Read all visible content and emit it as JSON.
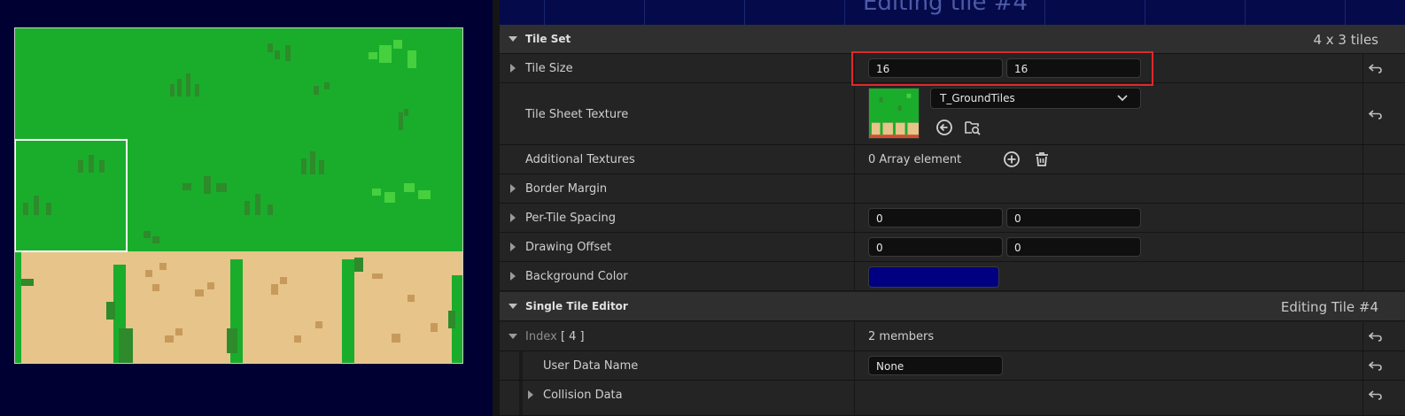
{
  "viewport": {
    "background": "#000033",
    "grass_color": "#1aad2c",
    "dirt_color": "#e6c48a",
    "selection_color": "#ffffff",
    "selected_tile_index": 4
  },
  "details": {
    "header_title": "Editing tile #4",
    "tile_set": {
      "label": "Tile Set",
      "info": "4 x 3 tiles"
    },
    "rows": {
      "tile_size": {
        "label": "Tile Size",
        "x": "16",
        "y": "16"
      },
      "tile_sheet_texture": {
        "label": "Tile Sheet Texture",
        "asset": "T_GroundTiles"
      },
      "additional_textures": {
        "label": "Additional Textures",
        "value": "0 Array element"
      },
      "border_margin": {
        "label": "Border Margin"
      },
      "per_tile_spacing": {
        "label": "Per-Tile Spacing",
        "x": "0",
        "y": "0"
      },
      "drawing_offset": {
        "label": "Drawing Offset",
        "x": "0",
        "y": "0"
      },
      "background_color": {
        "label": "Background Color",
        "color": "#000080"
      }
    },
    "single_tile_editor": {
      "label": "Single Tile Editor",
      "info": "Editing Tile #4"
    },
    "index_row": {
      "label": "Index",
      "index_value": "[ 4 ]",
      "value": "2 members"
    },
    "user_data_name": {
      "label": "User Data Name",
      "value": "None"
    },
    "collision_data": {
      "label": "Collision Data"
    }
  },
  "icons": {
    "reset": "reset-arrow-icon",
    "add": "plus-circle-icon",
    "delete": "trash-icon",
    "use_selected": "arrow-left-circle-icon",
    "browse": "browse-folder-icon"
  }
}
